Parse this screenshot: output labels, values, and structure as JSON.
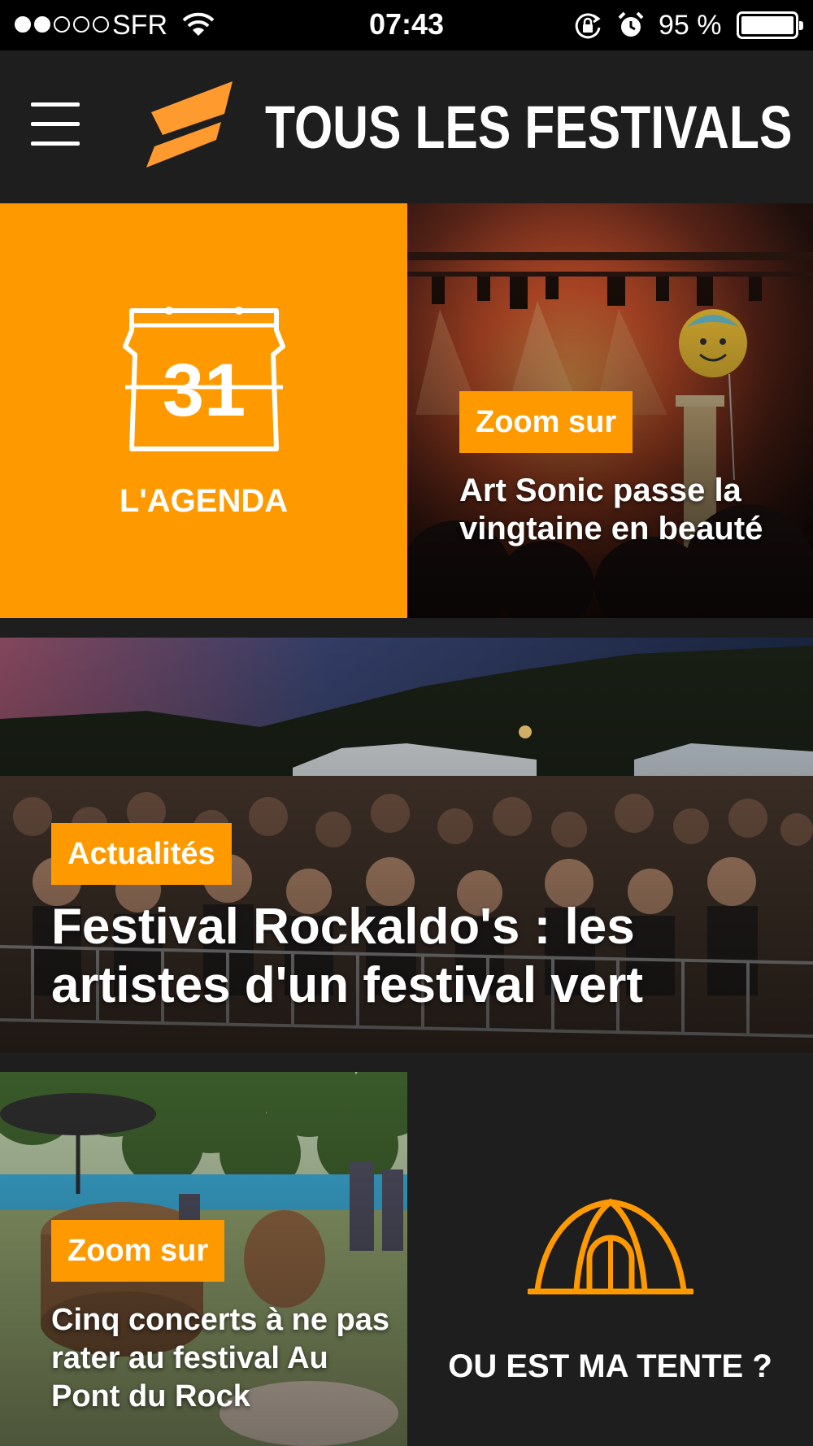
{
  "status_bar": {
    "carrier": "SFR",
    "time": "07:43",
    "battery_percent": "95 %",
    "signal_bars_filled": 2,
    "signal_bars_total": 5,
    "icons": [
      "wifi-icon",
      "rotation-lock-icon",
      "alarm-icon",
      "battery-icon"
    ]
  },
  "header": {
    "title": "TOUS LES FESTIVALS",
    "menu_icon": "hamburger-menu-icon",
    "logo_icon": "festival-logo-icon"
  },
  "colors": {
    "accent": "#ff9900",
    "background": "#1e1e1e",
    "statusbar": "#000000",
    "text": "#ffffff"
  },
  "tiles": {
    "agenda": {
      "label": "L'AGENDA",
      "icon_text": "31",
      "icon": "calendar-icon"
    },
    "art_sonic": {
      "category": "Zoom sur",
      "title": "Art Sonic passe la vingtaine en beauté"
    },
    "rockaldo": {
      "category": "Actualités",
      "title": "Festival Rockaldo's : les artistes d'un festival vert"
    },
    "pont_du_rock": {
      "category": "Zoom sur",
      "title": "Cinq concerts à ne pas rater au festival Au Pont du Rock"
    },
    "tente": {
      "label": "OU EST MA TENTE ?",
      "icon": "tent-icon"
    }
  }
}
